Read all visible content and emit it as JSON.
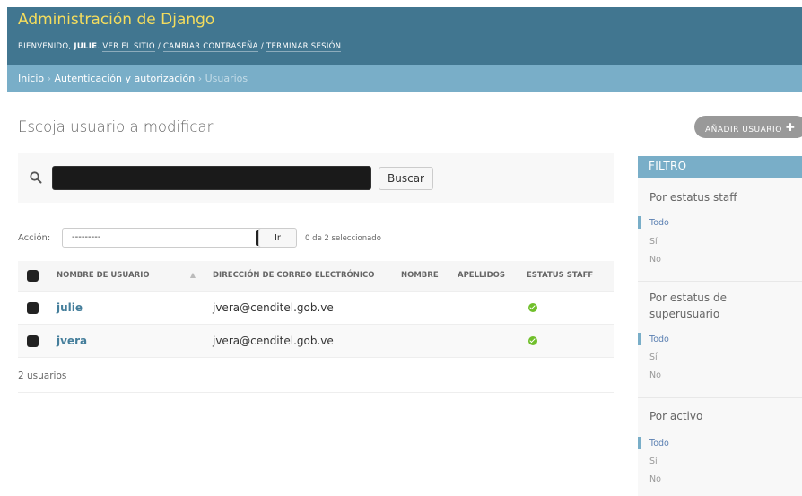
{
  "header": {
    "site_title": "Administración de Django",
    "welcome": "BIENVENIDO,",
    "username": "JULIE",
    "view_site": "VER EL SITIO",
    "change_password": "CAMBIAR CONTRASEÑA",
    "logout": "TERMINAR SESIÓN",
    "separator": "/"
  },
  "breadcrumbs": {
    "home": "Inicio",
    "app": "Autenticación y autorización",
    "current": "Usuarios",
    "sep": "›"
  },
  "page": {
    "title": "Escoja usuario a modificar",
    "add_button": "AÑADIR USUARIO"
  },
  "search": {
    "value": "",
    "button": "Buscar"
  },
  "actions": {
    "label": "Acción:",
    "selected_option": "---------",
    "go_button": "Ir",
    "counter": "0 de 2 seleccionado"
  },
  "table": {
    "headers": {
      "username": "NOMBRE DE USUARIO",
      "email": "DIRECCIÓN DE CORREO ELECTRÓNICO",
      "first_name": "NOMBRE",
      "last_name": "APELLIDOS",
      "staff": "ESTATUS STAFF"
    },
    "rows": [
      {
        "username": "julie",
        "email": "jvera@cenditel.gob.ve",
        "first_name": "",
        "last_name": "",
        "staff": true
      },
      {
        "username": "jvera",
        "email": "jvera@cenditel.gob.ve",
        "first_name": "",
        "last_name": "",
        "staff": true
      }
    ],
    "paginator": "2 usuarios"
  },
  "filter": {
    "title": "FILTRO",
    "groups": [
      {
        "heading": "Por estatus staff",
        "options": [
          "Todo",
          "Sí",
          "No"
        ],
        "selected": "Todo"
      },
      {
        "heading": "Por estatus de superusuario",
        "options": [
          "Todo",
          "Sí",
          "No"
        ],
        "selected": "Todo"
      },
      {
        "heading": "Por activo",
        "options": [
          "Todo",
          "Sí",
          "No"
        ],
        "selected": "Todo"
      }
    ]
  },
  "colors": {
    "header_bg": "#417690",
    "breadcrumb_bg": "#79aec8",
    "title_color": "#f5dd5d",
    "link_color": "#447e9b",
    "yes_icon": "#70bf2b"
  },
  "icons": {
    "search": "search-icon",
    "add": "plus-icon",
    "sort": "sort-asc-icon",
    "yes": "check-circle-icon"
  }
}
